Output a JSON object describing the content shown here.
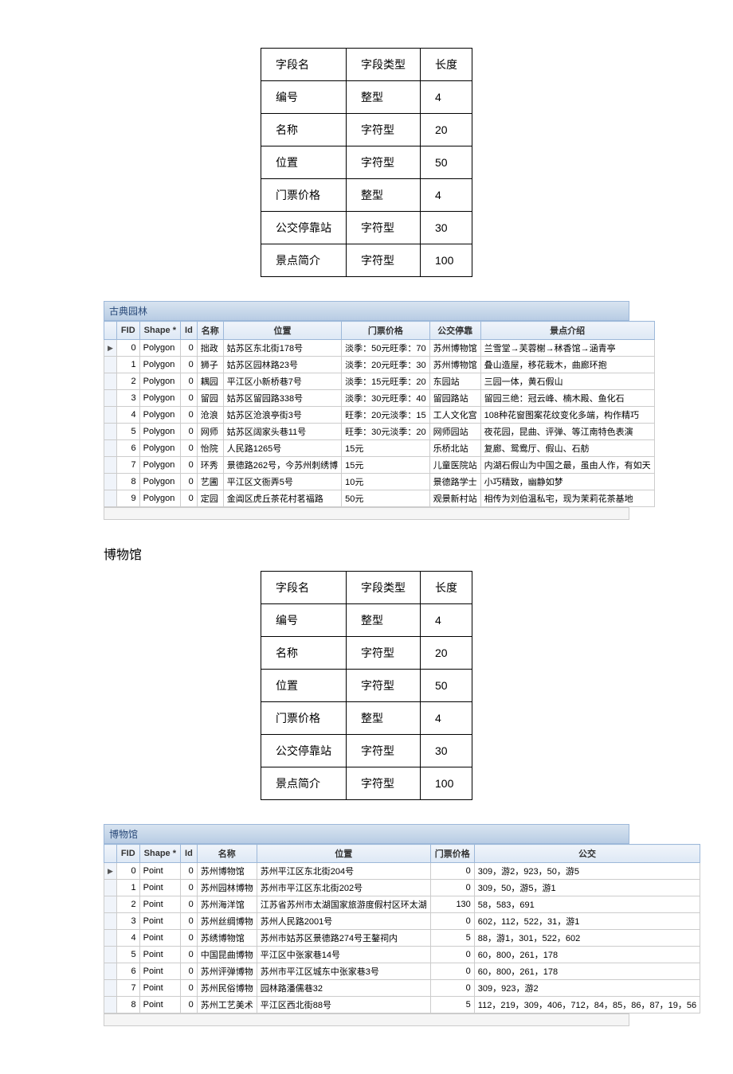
{
  "schema1": {
    "headers": [
      "字段名",
      "字段类型",
      "长度"
    ],
    "rows": [
      [
        "编号",
        "整型",
        "4"
      ],
      [
        "名称",
        "字符型",
        "20"
      ],
      [
        "位置",
        "字符型",
        "50"
      ],
      [
        "门票价格",
        "整型",
        "4"
      ],
      [
        "公交停靠站",
        "字符型",
        "30"
      ],
      [
        "景点简介",
        "字符型",
        "100"
      ]
    ]
  },
  "grid1": {
    "title": "古典园林",
    "headers": [
      "FID",
      "Shape *",
      "Id",
      "名称",
      "位置",
      "门票价格",
      "公交停靠",
      "景点介绍"
    ],
    "rows": [
      [
        "0",
        "Polygon",
        "0",
        "拙政",
        "姑苏区东北街178号",
        "淡季：50元旺季：70",
        "苏州博物馆",
        "兰雪堂→芙蓉榭→秫香馆→涵青亭"
      ],
      [
        "1",
        "Polygon",
        "0",
        "狮子",
        "姑苏区园林路23号",
        "淡季：20元旺季：30",
        "苏州博物馆",
        "叠山造屋，移花栽木，曲廊环抱"
      ],
      [
        "2",
        "Polygon",
        "0",
        "耦园",
        "平江区小新桥巷7号",
        "淡季：15元旺季：20",
        "东园站",
        "三园一体，黄石假山"
      ],
      [
        "3",
        "Polygon",
        "0",
        "留园",
        "姑苏区留园路338号",
        "淡季：30元旺季：40",
        "留园路站",
        "留园三绝：冠云峰、楠木殿、鱼化石"
      ],
      [
        "4",
        "Polygon",
        "0",
        "沧浪",
        "姑苏区沧浪亭街3号",
        "旺季：20元淡季：15",
        "工人文化宫",
        "108种花窗图案花纹变化多端，构作精巧"
      ],
      [
        "5",
        "Polygon",
        "0",
        "网师",
        "姑苏区阔家头巷11号",
        "旺季：30元淡季：20",
        "网师园站",
        "夜花园，昆曲、评弹、等江南特色表演"
      ],
      [
        "6",
        "Polygon",
        "0",
        "怡院",
        "人民路1265号",
        "15元",
        "乐桥北站",
        "复廊、鸳鸯厅、假山、石舫"
      ],
      [
        "7",
        "Polygon",
        "0",
        "环秀",
        "景德路262号，今苏州刺绣博",
        "15元",
        "儿童医院站",
        "内湖石假山为中国之最，虽由人作，有如天"
      ],
      [
        "8",
        "Polygon",
        "0",
        "艺圃",
        "平江区文衙弄5号",
        "10元",
        "景德路学士",
        "小巧精致，幽静如梦"
      ],
      [
        "9",
        "Polygon",
        "0",
        "定园",
        "金阊区虎丘茶花村茗福路",
        "50元",
        "观景新村站",
        "相传为刘伯温私宅，现为茉莉花茶基地"
      ]
    ]
  },
  "section2_title": "博物馆",
  "schema2": {
    "headers": [
      "字段名",
      "字段类型",
      "长度"
    ],
    "rows": [
      [
        "编号",
        "整型",
        "4"
      ],
      [
        "名称",
        "字符型",
        "20"
      ],
      [
        "位置",
        "字符型",
        "50"
      ],
      [
        "门票价格",
        "整型",
        "4"
      ],
      [
        "公交停靠站",
        "字符型",
        "30"
      ],
      [
        "景点简介",
        "字符型",
        "100"
      ]
    ]
  },
  "grid2": {
    "title": "博物馆",
    "headers": [
      "FID",
      "Shape *",
      "Id",
      "名称",
      "位置",
      "门票价格",
      "公交"
    ],
    "rows": [
      [
        "0",
        "Point",
        "0",
        "苏州博物馆",
        "苏州平江区东北街204号",
        "0",
        "309，游2，923，50，游5"
      ],
      [
        "1",
        "Point",
        "0",
        "苏州园林博物",
        "苏州市平江区东北街202号",
        "0",
        "309，50，游5，游1"
      ],
      [
        "2",
        "Point",
        "0",
        "苏州海洋馆",
        "江苏省苏州市太湖国家旅游度假村区环太湖",
        "130",
        "58，583，691"
      ],
      [
        "3",
        "Point",
        "0",
        "苏州丝绸博物",
        "苏州人民路2001号",
        "0",
        "602，112，522，31，游1"
      ],
      [
        "4",
        "Point",
        "0",
        "苏绣博物馆",
        "苏州市姑苏区景德路274号王鏊祠内",
        "5",
        "88，游1，301，522，602"
      ],
      [
        "5",
        "Point",
        "0",
        "中国昆曲博物",
        "平江区中张家巷14号",
        "0",
        "60，800，261，178"
      ],
      [
        "6",
        "Point",
        "0",
        "苏州评弹博物",
        "苏州市平江区城东中张家巷3号",
        "0",
        "60，800，261，178"
      ],
      [
        "7",
        "Point",
        "0",
        "苏州民俗博物",
        "园林路潘儒巷32",
        "0",
        "309，923，游2"
      ],
      [
        "8",
        "Point",
        "0",
        "苏州工艺美术",
        "平江区西北街88号",
        "5",
        "112，219，309，406，712，84，85，86，87，19，56"
      ]
    ]
  }
}
